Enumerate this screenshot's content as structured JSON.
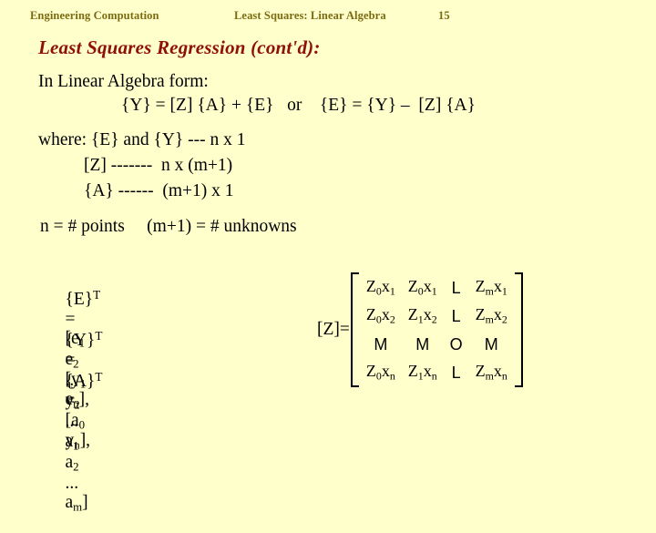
{
  "slide": {
    "background_color": "#FFFFCC",
    "header": {
      "left": "Engineering Computation",
      "center": "Least Squares: Linear Algebra",
      "page": "15",
      "color": "#7B6A10"
    },
    "title": {
      "text": "Least Squares Regression (cont'd):",
      "color": "#8E1007"
    },
    "body": {
      "line_form": "In Linear Algebra form:",
      "line_equation": "{Y} = [Z] {A} + {E}   or    {E} = {Y} –  [Z] {A}",
      "line_where": "where: {E} and {Y} --- n x 1",
      "line_z_dims": "[Z] -------  n x (m+1)",
      "line_a_dims": "{A} ------  (m+1) x 1",
      "line_counts": "n = # points     (m+1) = # unknowns"
    },
    "vectors": [
      {
        "name": "E-transpose",
        "lhs_brace": "{E}",
        "lhs_sup": "T",
        "equals": "=",
        "open": "[",
        "terms": [
          {
            "base": "e",
            "sub": "1"
          },
          {
            "base": "e",
            "sub": "2"
          },
          {
            "base": "...",
            "sub": ""
          },
          {
            "base": "e",
            "sub": "n"
          }
        ],
        "close": "],"
      },
      {
        "name": "Y-transpose",
        "lhs_brace": "{Y}",
        "lhs_sup": "T",
        "equals": "=",
        "open": "[",
        "terms": [
          {
            "base": "y",
            "sub": "1"
          },
          {
            "base": "y",
            "sub": "2"
          },
          {
            "base": "...",
            "sub": ""
          },
          {
            "base": "y",
            "sub": "n"
          }
        ],
        "close": "],"
      },
      {
        "name": "A-transpose",
        "lhs_brace": "{A}",
        "lhs_sup": "T",
        "equals": "=",
        "open": "[",
        "terms": [
          {
            "base": "a",
            "sub": "0"
          },
          {
            "base": "a",
            "sub": "1"
          },
          {
            "base": "a",
            "sub": "2"
          },
          {
            "base": "...",
            "sub": ""
          },
          {
            "base": "a",
            "sub": "m"
          }
        ],
        "close": "]"
      }
    ],
    "matrix": {
      "label": "[Z]",
      "equals": "=",
      "rows": [
        [
          {
            "base": "Z",
            "sub": "0",
            "base2": "x",
            "sub2": "1",
            "type": "term"
          },
          {
            "base": "Z",
            "sub": "0",
            "base2": "x",
            "sub2": "1",
            "type": "term"
          },
          {
            "glyph": "L",
            "type": "ellipsis"
          },
          {
            "base": "Z",
            "sub": "m",
            "base2": "x",
            "sub2": "1",
            "type": "term"
          }
        ],
        [
          {
            "base": "Z",
            "sub": "0",
            "base2": "x",
            "sub2": "2",
            "type": "term"
          },
          {
            "base": "Z",
            "sub": "1",
            "base2": "x",
            "sub2": "2",
            "type": "term"
          },
          {
            "glyph": "L",
            "type": "ellipsis"
          },
          {
            "base": "Z",
            "sub": "m",
            "base2": "x",
            "sub2": "2",
            "type": "term"
          }
        ],
        [
          {
            "glyph": "M",
            "type": "ellipsis"
          },
          {
            "glyph": "M",
            "type": "ellipsis"
          },
          {
            "glyph": "O",
            "type": "ellipsis"
          },
          {
            "glyph": "M",
            "type": "ellipsis"
          }
        ],
        [
          {
            "base": "Z",
            "sub": "0",
            "base2": "x",
            "sub2": "n",
            "type": "term"
          },
          {
            "base": "Z",
            "sub": "1",
            "base2": "x",
            "sub2": "n",
            "type": "term"
          },
          {
            "glyph": "L",
            "type": "ellipsis"
          },
          {
            "base": "Z",
            "sub": "m",
            "base2": "x",
            "sub2": "n",
            "type": "term"
          }
        ]
      ]
    }
  }
}
